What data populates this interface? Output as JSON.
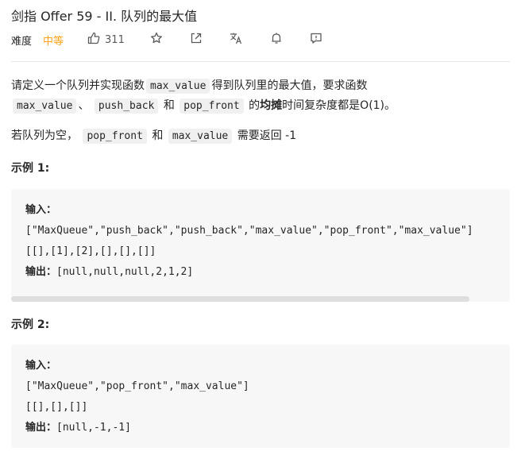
{
  "title": "剑指 Offer 59 - II. 队列的最大值",
  "meta": {
    "difficulty_label": "难度",
    "difficulty": "中等",
    "likes": "311",
    "icons": [
      "thumbs-up-icon",
      "star-icon",
      "share-icon",
      "translate-icon",
      "bell-icon",
      "feedback-icon"
    ]
  },
  "description": {
    "p1_a": "请定义一个队列并实现函数",
    "code_max_value": "max_value",
    "p1_b": "得到队列里的最大值，要求函数",
    "sep1": "、",
    "code_push_back": "push_back",
    "and1": "和",
    "code_pop_front": "pop_front",
    "p1_c": "的",
    "bold_amortized": "均摊",
    "p1_d": "时间复杂度都是O(1)。",
    "p2_a": "若队列为空，",
    "and2": "和",
    "p2_b": "需要返回 -1"
  },
  "example1": {
    "title": "示例 1:",
    "input_label": "输入：",
    "line1": "[\"MaxQueue\",\"push_back\",\"push_back\",\"max_value\",\"pop_front\",\"max_value\"]",
    "line2": "[[],[1],[2],[],[],[]]",
    "output_label": "输出：",
    "output": "[null,null,null,2,1,2]"
  },
  "example2": {
    "title": "示例 2:",
    "input_label": "输入：",
    "line1": "[\"MaxQueue\",\"pop_front\",\"max_value\"]",
    "line2": "[[],[],[]]",
    "output_label": "输出：",
    "output": "[null,-1,-1]"
  }
}
